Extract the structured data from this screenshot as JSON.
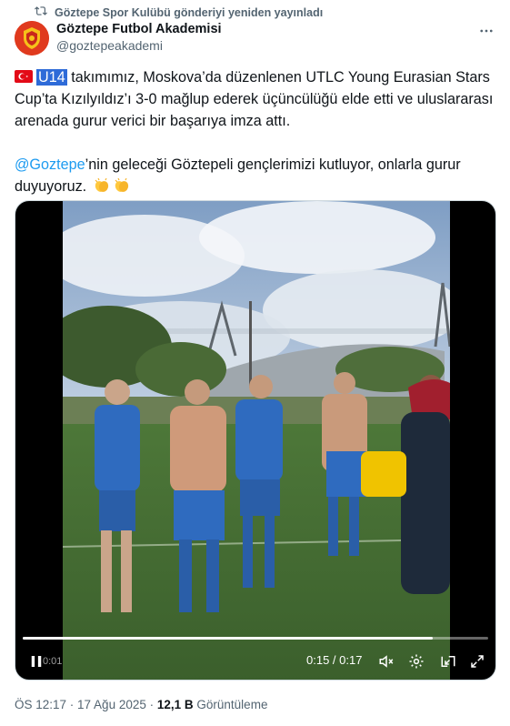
{
  "repost_text": "Göztepe Spor Kulübü gönderiyi yeniden yayınladı",
  "author": {
    "name": "Göztepe Futbol Akademisi",
    "handle": "@goztepeakademi"
  },
  "tweet": {
    "tag": "U14",
    "para1": "takımımız, Moskova’da düzenlenen UTLC Young Eurasian Stars Cup’ta Kızılyıldız’ı 3-0 mağlup ederek üçüncülüğü elde etti ve uluslararası arenada gurur verici bir başarıya imza attı.",
    "mention": "@Goztepe",
    "para2": "’nin geleceği Göztepeli gençlerimizi kutluyor, onlarla gurur duyuyoruz."
  },
  "video": {
    "current_time": "0:15",
    "separator": " / ",
    "duration": "0:17",
    "progress": 0.88,
    "ghost_time": "0:01"
  },
  "footer": {
    "timestamp": "ÖS 12:17 · 17 Ağu 2025 · ",
    "views_count": "12,1 B",
    "views_label": "Görüntüleme"
  },
  "icons": {
    "repost": "repost-icon",
    "more": "more-icon",
    "play_pause": "pause-icon",
    "volume": "mute-icon",
    "settings": "gear-icon",
    "pip": "picture-in-picture-icon",
    "fullscreen": "fullscreen-icon"
  },
  "colors": {
    "link": "#1d9bf0",
    "highlight": "#2e6bd8",
    "secondary": "#536471",
    "brand": "#e03a1e"
  }
}
